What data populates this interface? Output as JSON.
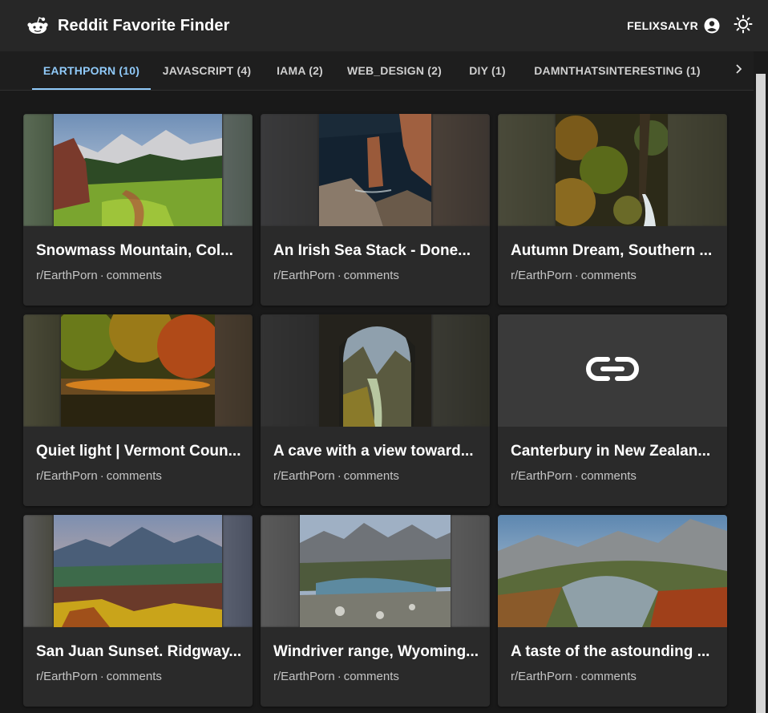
{
  "app": {
    "title": "Reddit Favorite Finder"
  },
  "user": {
    "name": "FELIXSALYR"
  },
  "tabs": [
    {
      "label": "EARTHPORN (10)"
    },
    {
      "label": "JAVASCRIPT (4)"
    },
    {
      "label": "IAMA (2)"
    },
    {
      "label": "WEB_DESIGN (2)"
    },
    {
      "label": "DIY (1)"
    },
    {
      "label": "DAMNTHATSINTERESTING (1)"
    }
  ],
  "cards": [
    {
      "title": "Snowmass Mountain, Col...",
      "subreddit": "r/EarthPorn",
      "comments": "comments"
    },
    {
      "title": "An Irish Sea Stack - Done...",
      "subreddit": "r/EarthPorn",
      "comments": "comments"
    },
    {
      "title": "Autumn Dream, Southern ...",
      "subreddit": "r/EarthPorn",
      "comments": "comments"
    },
    {
      "title": "Quiet light | Vermont Coun...",
      "subreddit": "r/EarthPorn",
      "comments": "comments"
    },
    {
      "title": "A cave with a view toward...",
      "subreddit": "r/EarthPorn",
      "comments": "comments"
    },
    {
      "title": "Canterbury in New Zealan...",
      "subreddit": "r/EarthPorn",
      "comments": "comments"
    },
    {
      "title": "San Juan Sunset. Ridgway...",
      "subreddit": "r/EarthPorn",
      "comments": "comments"
    },
    {
      "title": "Windriver range, Wyoming...",
      "subreddit": "r/EarthPorn",
      "comments": "comments"
    },
    {
      "title": "A taste of the astounding ...",
      "subreddit": "r/EarthPorn",
      "comments": "comments"
    }
  ],
  "colors": {
    "appbar": "#272727",
    "background": "#191919",
    "card": "#2a2a2a",
    "accent": "#90caf9"
  },
  "icons": {
    "logo": "reddit-alien-icon",
    "account": "account-circle-icon",
    "theme": "sun-icon",
    "link": "link-icon",
    "scroll": "chevron-right-icon"
  }
}
